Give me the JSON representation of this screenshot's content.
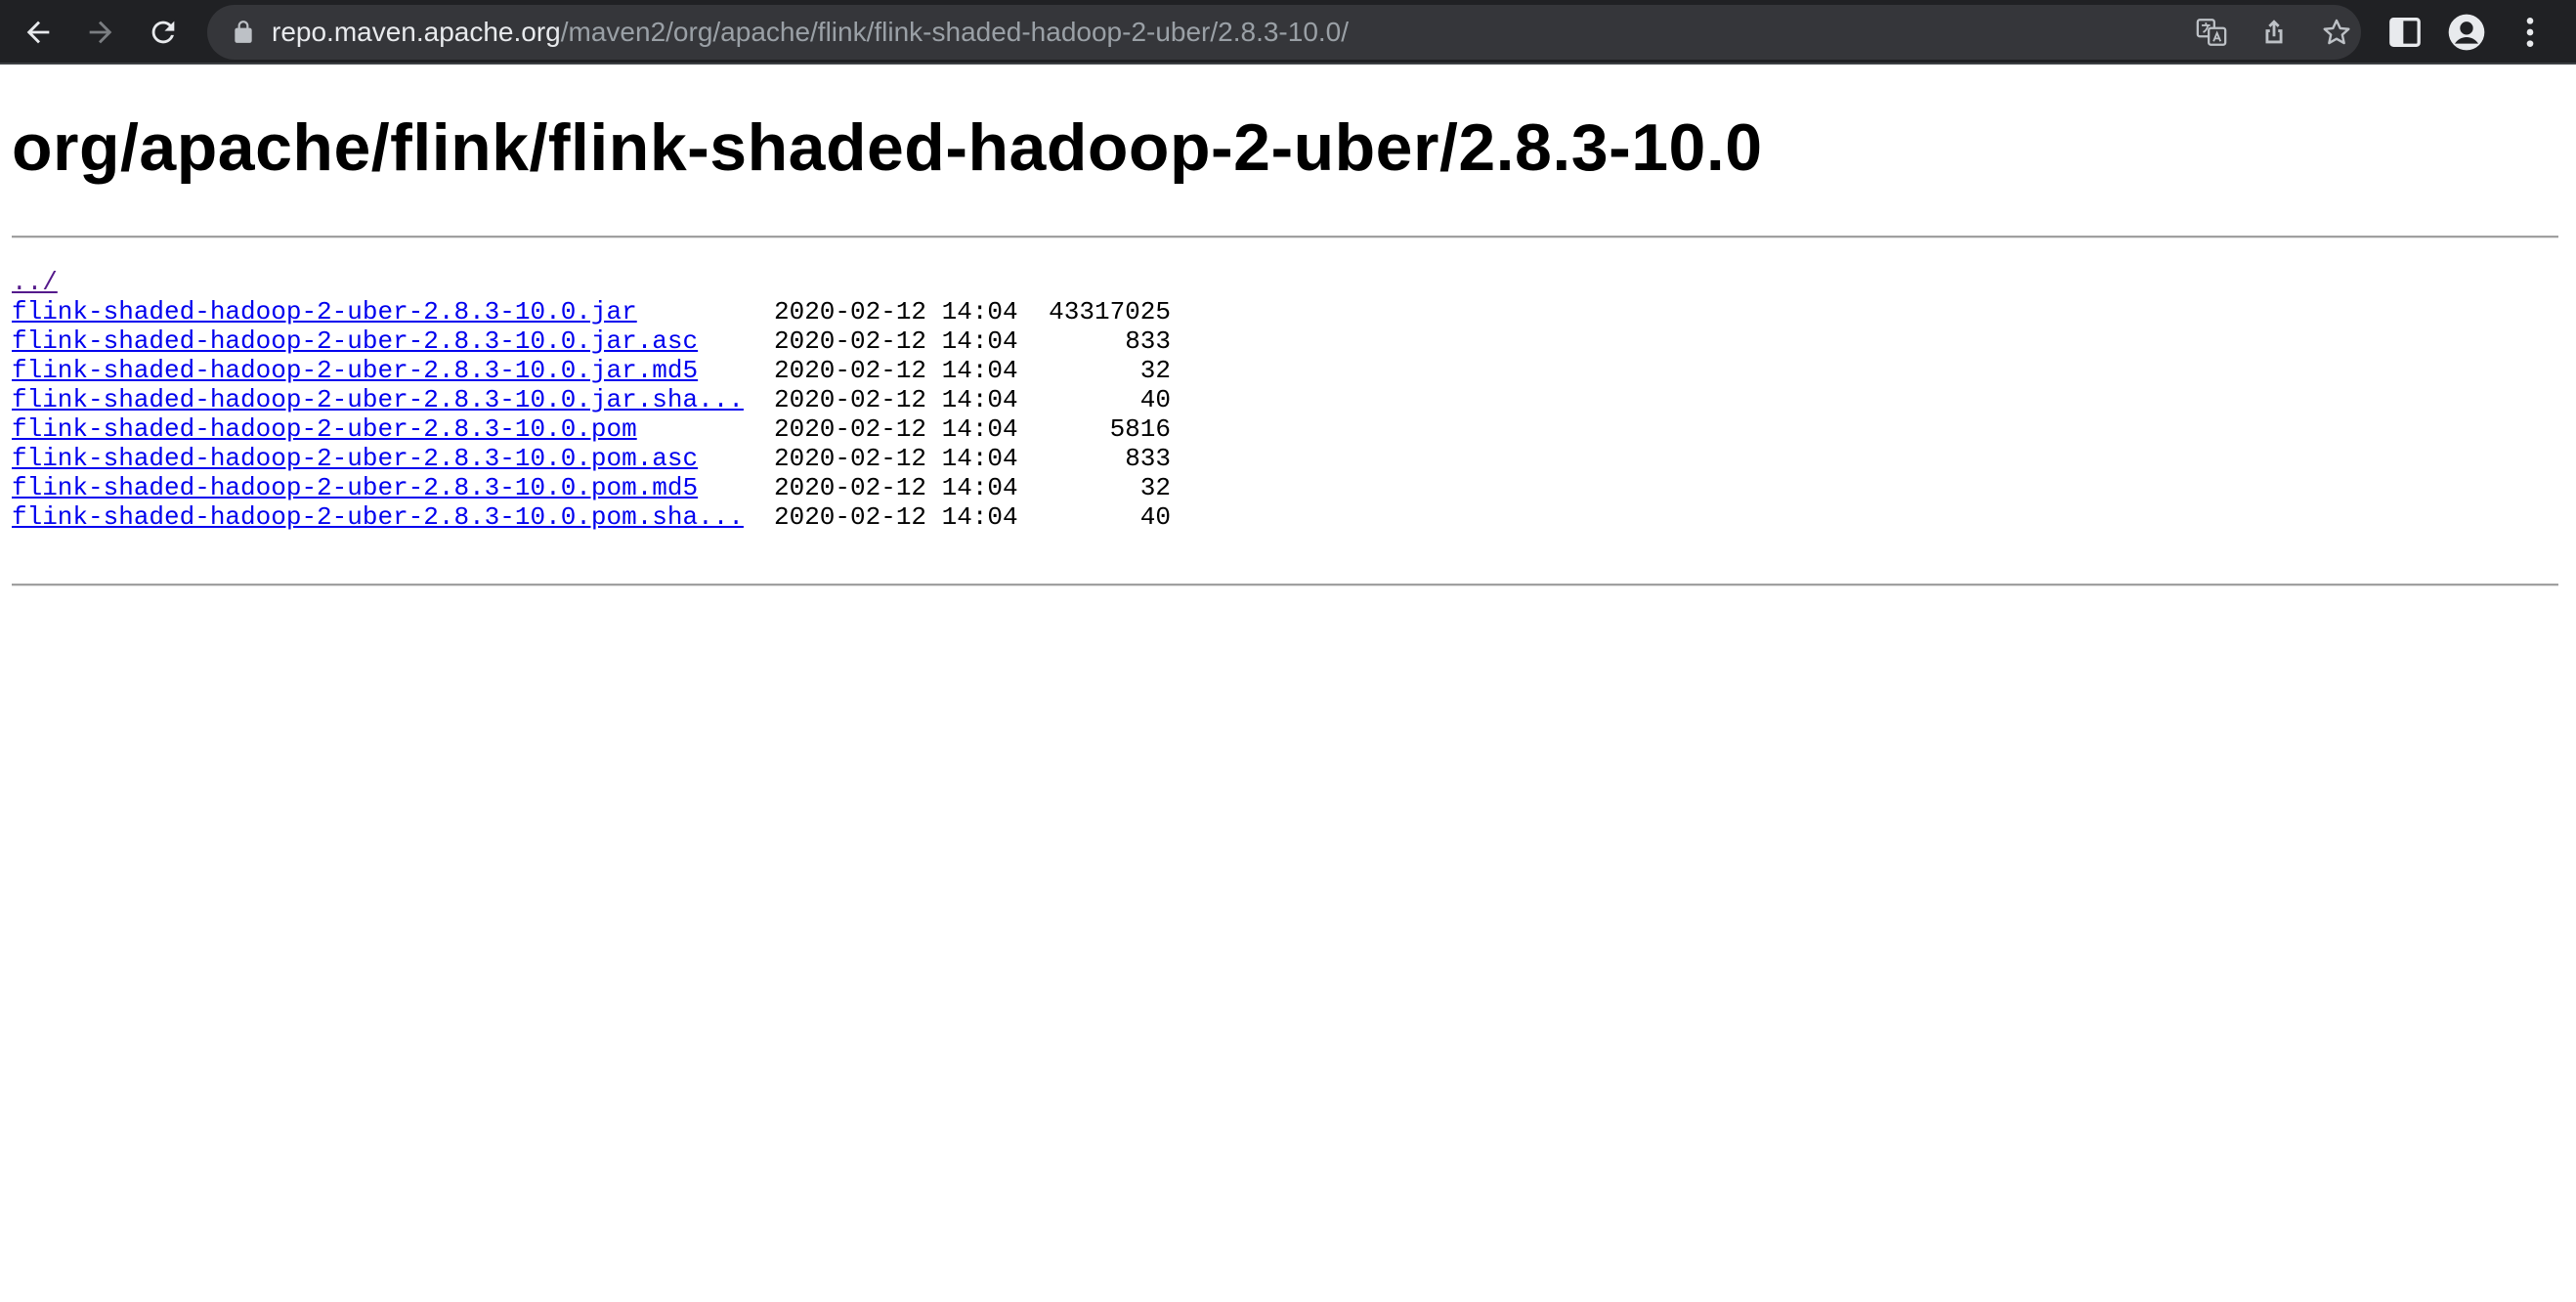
{
  "browser": {
    "url_host": "repo.maven.apache.org",
    "url_path": "/maven2/org/apache/flink/flink-shaded-hadoop-2-uber/2.8.3-10.0/",
    "icons": [
      "back-icon",
      "forward-icon",
      "reload-icon",
      "lock-icon",
      "translate-icon",
      "share-icon",
      "bookmark-star-icon",
      "side-panel-icon",
      "profile-icon",
      "menu-icon"
    ]
  },
  "page": {
    "title": "org/apache/flink/flink-shaded-hadoop-2-uber/2.8.3-10.0",
    "parent_link": "../",
    "files": [
      {
        "name": "flink-shaded-hadoop-2-uber-2.8.3-10.0.jar",
        "date": "2020-02-12 14:04",
        "size": "43317025"
      },
      {
        "name": "flink-shaded-hadoop-2-uber-2.8.3-10.0.jar.asc",
        "date": "2020-02-12 14:04",
        "size": "833"
      },
      {
        "name": "flink-shaded-hadoop-2-uber-2.8.3-10.0.jar.md5",
        "date": "2020-02-12 14:04",
        "size": "32"
      },
      {
        "name": "flink-shaded-hadoop-2-uber-2.8.3-10.0.jar.sha...",
        "date": "2020-02-12 14:04",
        "size": "40"
      },
      {
        "name": "flink-shaded-hadoop-2-uber-2.8.3-10.0.pom",
        "date": "2020-02-12 14:04",
        "size": "5816"
      },
      {
        "name": "flink-shaded-hadoop-2-uber-2.8.3-10.0.pom.asc",
        "date": "2020-02-12 14:04",
        "size": "833"
      },
      {
        "name": "flink-shaded-hadoop-2-uber-2.8.3-10.0.pom.md5",
        "date": "2020-02-12 14:04",
        "size": "32"
      },
      {
        "name": "flink-shaded-hadoop-2-uber-2.8.3-10.0.pom.sha...",
        "date": "2020-02-12 14:04",
        "size": "40"
      }
    ]
  },
  "colors": {
    "toolbar_bg": "#202124",
    "omnibox_bg": "#35363a",
    "link": "#0000ee",
    "visited_link": "#551a8b"
  }
}
